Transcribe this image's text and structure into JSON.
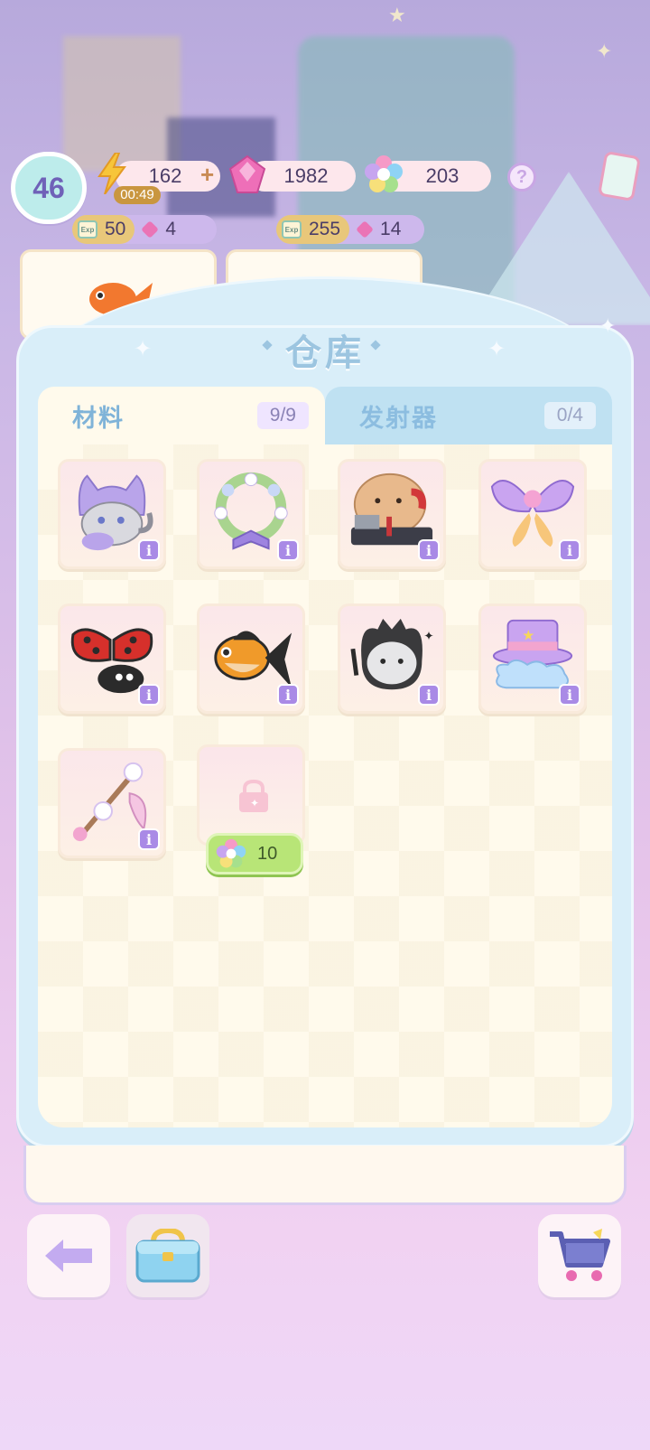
{
  "hud": {
    "level": "46",
    "energy": "162",
    "energy_timer": "00:49",
    "energy_plus": "+",
    "gems": "1982",
    "rainbow": "203",
    "help": "?"
  },
  "sub_stats": {
    "left_exp": "50",
    "left_gem": "4",
    "right_exp": "255",
    "right_gem": "14",
    "exp_tag": "Exp"
  },
  "warehouse": {
    "title": "仓库",
    "tabs": [
      {
        "label": "材料",
        "count": "9/9"
      },
      {
        "label": "发射器",
        "count": "0/4"
      }
    ],
    "items": [
      {
        "name": "purple-hood-kitten",
        "info": "i"
      },
      {
        "name": "flower-wreath",
        "info": "i"
      },
      {
        "name": "office-bear-phone",
        "info": "i"
      },
      {
        "name": "butterfly-fairy",
        "info": "i"
      },
      {
        "name": "ladybug",
        "info": "i"
      },
      {
        "name": "calico-goldfish",
        "info": "i"
      },
      {
        "name": "shadow-cat-spirit",
        "info": "i"
      },
      {
        "name": "magician-hat-cloud",
        "info": "i"
      },
      {
        "name": "flower-wand",
        "info": "i"
      }
    ],
    "unlock_cost": "10"
  },
  "colors": {
    "accent": "#a98ae6",
    "panel": "#d9eef9",
    "unlock_green": "#b8e577"
  }
}
